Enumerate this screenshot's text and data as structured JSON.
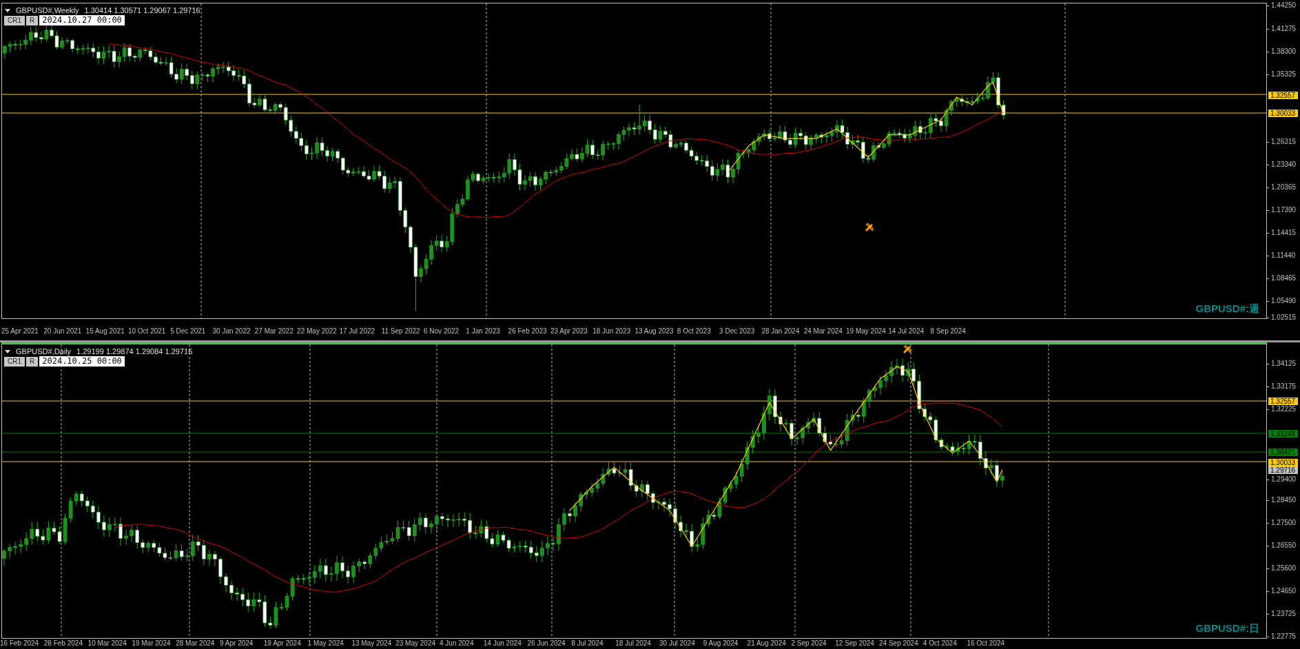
{
  "panels": [
    {
      "selected": false,
      "symbol": "GBPUSD#,Weekly",
      "ohlc": "1.30414 1.30571 1.29067 1.29716",
      "buttons": [
        "CR1",
        "R"
      ],
      "time_field": "2024.10.27 00:00",
      "watermark": "GBPUSD#:週",
      "price_scale": [
        "1.44250",
        "1.41275",
        "1.38300",
        "1.35325",
        "1.26315",
        "1.23340",
        "1.20365",
        "1.17390",
        "1.14415",
        "1.11440",
        "1.08465",
        "1.05490",
        "1.02515"
      ],
      "price_tags": [
        {
          "kind": "line",
          "text": "1.32557",
          "color": "#ffcc00"
        },
        {
          "kind": "line",
          "text": "1.30033",
          "color": "#ffcc00"
        }
      ],
      "dates": [
        "25 Apr 2021",
        "20 Jun 2021",
        "15 Aug 2021",
        "10 Oct 2021",
        "5 Dec 2021",
        "30 Jan 2022",
        "27 Mar 2022",
        "22 May 2022",
        "17 Jul 2022",
        "11 Sep 2022",
        "6 Nov 2022",
        "1 Jan 2023",
        "26 Feb 2023",
        "23 Apr 2023",
        "18 Jun 2023",
        "13 Aug 2023",
        "8 Oct 2023",
        "3 Dec 2023",
        "28 Jan 2024",
        "24 Mar 2024",
        "19 May 2024",
        "14 Jul 2024",
        "8 Sep 2024"
      ]
    },
    {
      "selected": true,
      "symbol": "GBPUSD#,Daily",
      "ohlc": "1.29199 1.29874 1.29084 1.29716",
      "buttons": [
        "CR1",
        "R"
      ],
      "time_field": "2024.10.25 00:00",
      "watermark": "GBPUSD#:日",
      "price_scale": [
        "1.34125",
        "1.33175",
        "1.32225",
        "1.29400",
        "1.28450",
        "1.27500",
        "1.26550",
        "1.25600",
        "1.24650",
        "1.23725",
        "1.22775"
      ],
      "price_tags": [
        {
          "kind": "line",
          "text": "1.32557",
          "color": "#ffcc00"
        },
        {
          "kind": "line",
          "text": "1.31193",
          "color": "#008000"
        },
        {
          "kind": "line",
          "text": "1.30421",
          "color": "#008000"
        },
        {
          "kind": "line",
          "text": "1.30033",
          "color": "#ffcc00"
        },
        {
          "kind": "bid",
          "text": "1.29716",
          "color": "#c0c0c0"
        }
      ],
      "dates": [
        "16 Feb 2024",
        "28 Feb 2024",
        "10 Mar 2024",
        "19 Mar 2024",
        "28 Mar 2024",
        "9 Apr 2024",
        "19 Apr 2024",
        "1 May 2024",
        "13 May 2024",
        "23 May 2024",
        "4 Jun 2024",
        "14 Jun 2024",
        "26 Jun 2024",
        "8 Jul 2024",
        "18 Jul 2024",
        "30 Jul 2024",
        "9 Aug 2024",
        "21 Aug 2024",
        "2 Sep 2024",
        "12 Sep 2024",
        "24 Sep 2024",
        "4 Oct 2024",
        "16 Oct 2024"
      ]
    }
  ]
}
